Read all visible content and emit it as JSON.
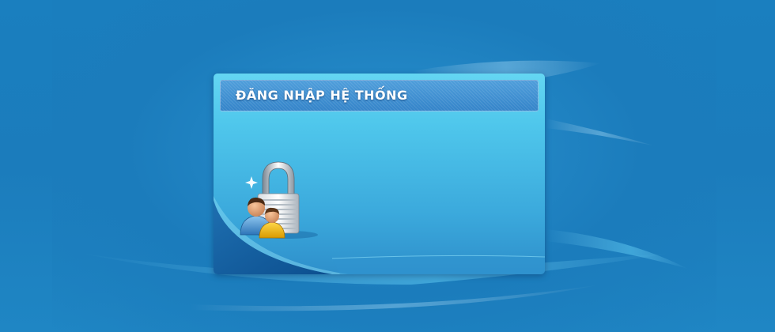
{
  "login_panel": {
    "title": "ĐĂNG NHẬP HỆ THỐNG",
    "icon": "user-lock-icon"
  },
  "colors": {
    "background": "#1b7cbc",
    "panel_top": "#64d6f2",
    "panel_bottom": "#2e8fcb",
    "header": "#3a8ed0",
    "title_text": "#ffffff"
  }
}
